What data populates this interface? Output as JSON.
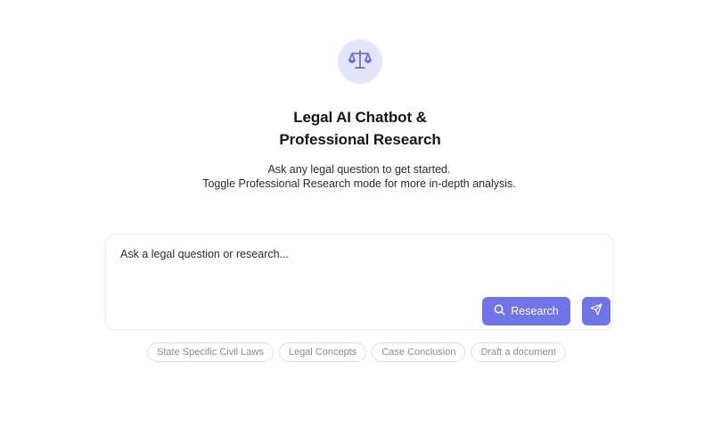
{
  "app": {
    "icon": "scales-of-justice-icon",
    "title_line1": "Legal AI Chatbot &",
    "title_line2": "Professional Research",
    "subtitle_line1": "Ask any legal question to get started.",
    "subtitle_line2": "Toggle Professional Research mode for more in-depth analysis."
  },
  "composer": {
    "placeholder": "Ask a legal question or research...",
    "value": "",
    "research_label": "Research",
    "research_icon": "search-icon",
    "send_icon": "send-icon"
  },
  "suggestions": [
    {
      "label": "State Specific Civil Laws"
    },
    {
      "label": "Legal Concepts"
    },
    {
      "label": "Case Conclusion"
    },
    {
      "label": "Draft a document"
    }
  ],
  "colors": {
    "accent": "#7173e8",
    "icon_bg": "#e3e5fb",
    "text": "#141419"
  }
}
